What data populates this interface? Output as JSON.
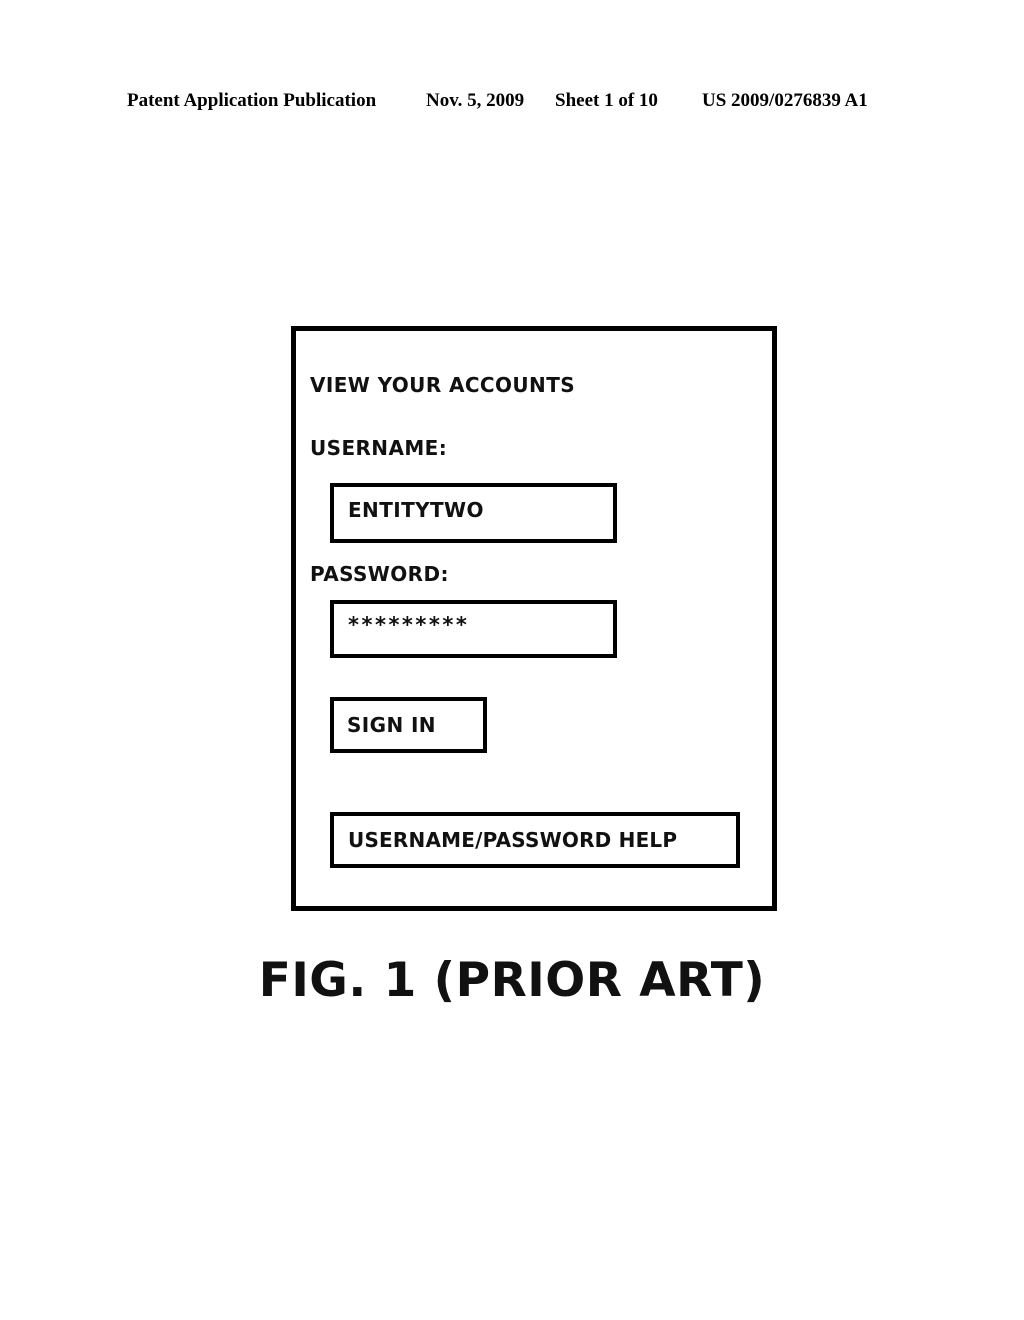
{
  "page": {
    "background_color": "#ffffff",
    "ink_color": "#000000"
  },
  "header": {
    "publication": "Patent Application Publication",
    "date": "Nov. 5, 2009",
    "sheet": "Sheet 1 of 10",
    "patent_number": "US 2009/0276839 A1"
  },
  "figure": {
    "caption": "FIG. 1 (PRIOR ART)",
    "login_screen": {
      "title": "VIEW YOUR ACCOUNTS",
      "username_label": "USERNAME:",
      "username_value": "ENTITYTWO",
      "username_placeholder": "",
      "password_label": "PASSWORD:",
      "password_value": "*********",
      "password_placeholder": "",
      "sign_in_label": "SIGN IN",
      "help_label": "USERNAME/PASSWORD HELP"
    }
  }
}
